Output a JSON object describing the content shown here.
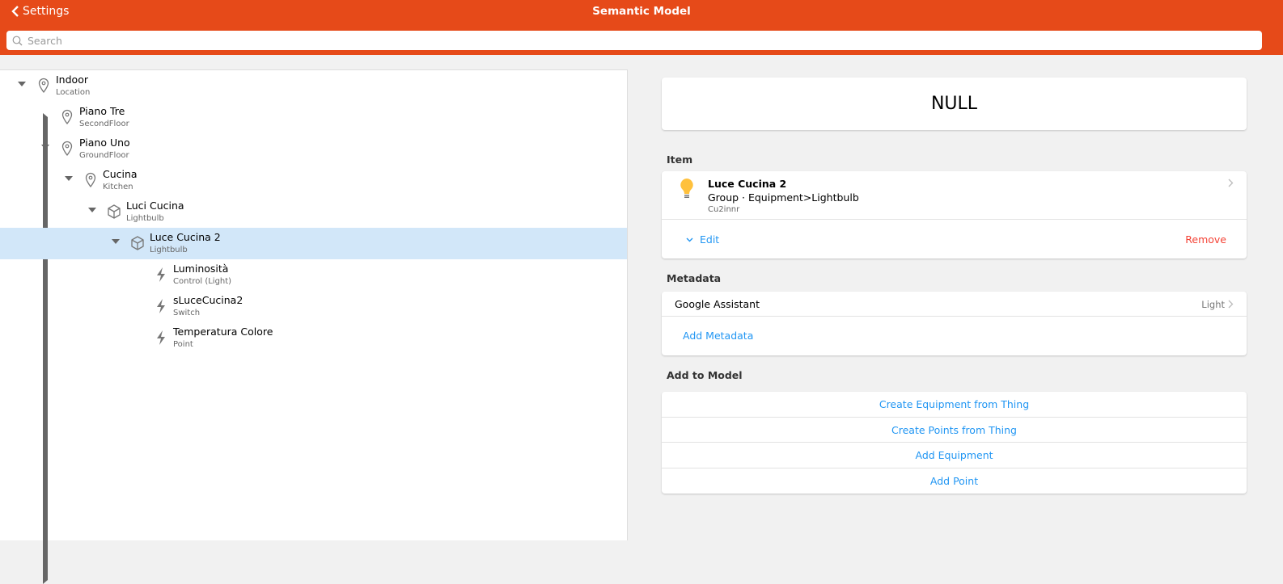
{
  "header": {
    "back_label": "Settings",
    "title": "Semantic Model",
    "search_placeholder": "Search"
  },
  "tree": [
    {
      "label": "Indoor",
      "sub": "Location",
      "level": 0,
      "icon": "location-pin-icon",
      "expand": "down"
    },
    {
      "label": "Piano Tre",
      "sub": "SecondFloor",
      "level": 1,
      "icon": "location-pin-icon",
      "expand": "right"
    },
    {
      "label": "Piano Uno",
      "sub": "GroundFloor",
      "level": 1,
      "icon": "location-pin-icon",
      "expand": "down"
    },
    {
      "label": "Cucina",
      "sub": "Kitchen",
      "level": 2,
      "icon": "location-pin-icon",
      "expand": "down"
    },
    {
      "label": "Luci Cucina",
      "sub": "Lightbulb",
      "level": 3,
      "icon": "cube-icon",
      "expand": "down"
    },
    {
      "label": "Luce Cucina 2",
      "sub": "Lightbulb",
      "level": 4,
      "icon": "cube-icon",
      "expand": "down",
      "selected": true
    },
    {
      "label": "Luminosità",
      "sub": "Control (Light)",
      "level": 5,
      "icon": "bolt-icon",
      "expand": "none"
    },
    {
      "label": "sLuceCucina2",
      "sub": "Switch",
      "level": 5,
      "icon": "bolt-icon",
      "expand": "none"
    },
    {
      "label": "Temperatura Colore",
      "sub": "Point",
      "level": 5,
      "icon": "bolt-icon",
      "expand": "none"
    }
  ],
  "state": "NULL",
  "item": {
    "section": "Item",
    "name": "Luce Cucina 2",
    "type": "Group · Equipment>Lightbulb",
    "id": "Cu2innr",
    "edit": "Edit",
    "remove": "Remove"
  },
  "metadata": {
    "section": "Metadata",
    "entries": [
      {
        "name": "Google Assistant",
        "value": "Light"
      }
    ],
    "add": "Add Metadata"
  },
  "model": {
    "section": "Add to Model",
    "actions": [
      "Create Equipment from Thing",
      "Create Points from Thing",
      "Add Equipment",
      "Add Point"
    ]
  },
  "colors": {
    "accent": "#e64a19",
    "link": "#2196f3",
    "danger": "#f44336",
    "selected": "#d2e7f9"
  }
}
